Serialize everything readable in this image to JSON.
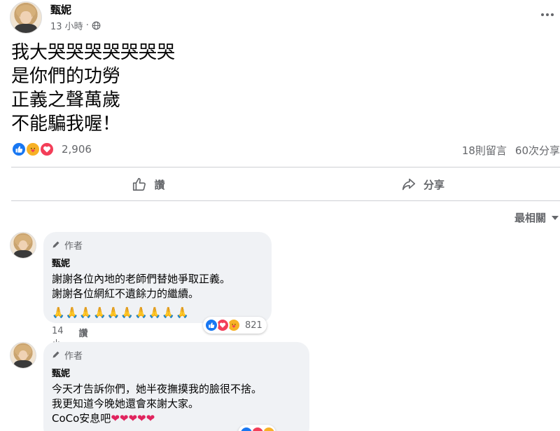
{
  "post": {
    "author": "甄妮",
    "time": "13 小時",
    "separator": "·",
    "lines": [
      "我大哭哭哭哭哭哭哭",
      "是你們的功勞",
      "正義之聲萬歲",
      "不能騙我喔！"
    ],
    "reaction_count": "2,906",
    "comments_count": "18則留言",
    "shares_count": "60次分享"
  },
  "actions": {
    "like_label": "讚",
    "share_label": "分享"
  },
  "sort": {
    "label": "最相關"
  },
  "comments": [
    {
      "badge": "作者",
      "name": "甄妮",
      "lines": [
        "謝謝各位內地的老師們替她爭取正義。",
        "謝謝各位網紅不遺餘力的繼續。"
      ],
      "emoji_row": "🙏🙏🙏🙏🙏🙏🙏🙏🙏🙏",
      "time": "14小時",
      "like_label": "讚",
      "reaction_count": "821"
    },
    {
      "badge": "作者",
      "name": "甄妮",
      "lines": [
        "今天才告訴你們，她半夜撫摸我的臉很不捨。",
        "我更知道今晚她還會來謝大家。",
        "CoCo安息吧"
      ],
      "emoji_row": "❤❤❤❤❤"
    }
  ],
  "colors": {
    "like_blue": "#1877f2",
    "love_red": "#f33e58",
    "care_yellow": "#f7b125",
    "secondary_text": "#65676b",
    "bubble_bg": "#f0f2f5"
  }
}
